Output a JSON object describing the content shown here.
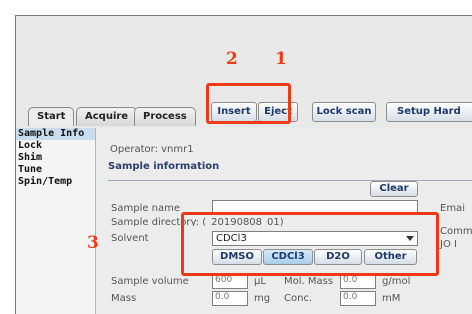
{
  "tabs": [
    {
      "label": "Start"
    },
    {
      "label": "Acquire"
    },
    {
      "label": "Process"
    }
  ],
  "toolbar": {
    "insert": "Insert",
    "eject": "Eject",
    "lock_scan": "Lock scan",
    "setup_hardware": "Setup Hard"
  },
  "sidebar": {
    "items": [
      {
        "label": "Sample Info",
        "selected": true
      },
      {
        "label": "Lock"
      },
      {
        "label": "Shim"
      },
      {
        "label": "Tune"
      },
      {
        "label": "Spin/Temp"
      }
    ]
  },
  "main": {
    "operator": "Operator: vnmr1",
    "section_title": "Sample information",
    "clear_label": "Clear",
    "sample_name_label": "Sample name",
    "sample_name_value": "",
    "sample_directory": "Sample directory: (_20190808_01)",
    "solvent_label": "Solvent",
    "solvent_value": "CDCl3",
    "solvent_buttons": [
      {
        "label": "DMSO"
      },
      {
        "label": "CDCl3",
        "selected": true
      },
      {
        "label": "D2O"
      },
      {
        "label": "Other"
      }
    ],
    "sample_volume_label": "Sample volume",
    "sample_volume_value": "600",
    "volume_unit": "μL",
    "mol_mass_label": "Mol. Mass",
    "mol_mass_value": "0.0",
    "mol_mass_unit": "g/mol",
    "mass_label": "Mass",
    "mass_value": "0.0",
    "mass_unit": "mg",
    "conc_label": "Conc.",
    "conc_value": "0.0",
    "conc_unit": "mM",
    "right_email": "Emai",
    "right_comment": "Comm",
    "right_io": "JO I"
  },
  "annotations": {
    "label1": "1",
    "label2": "2",
    "label3": "3",
    "color": "#f03a17"
  }
}
